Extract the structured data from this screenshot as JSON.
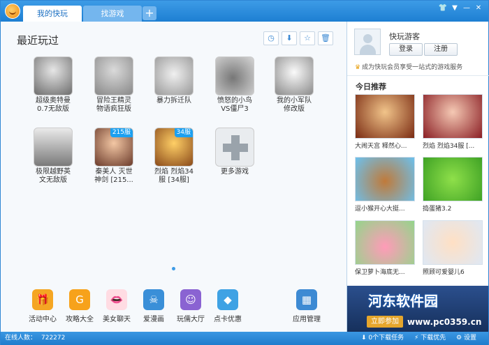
{
  "tabs": [
    {
      "label": "我的快玩"
    },
    {
      "label": "找游戏"
    }
  ],
  "tab_add_label": "+",
  "window_controls": [
    "👕",
    "▼",
    "—",
    "✕"
  ],
  "recent": {
    "title": "最近玩过",
    "tools": [
      {
        "icon": "clock-icon",
        "glyph": "◷"
      },
      {
        "icon": "download-icon",
        "glyph": "⬇"
      },
      {
        "icon": "star-icon",
        "glyph": "☆"
      },
      {
        "icon": "trash-icon",
        "glyph": "🗑"
      }
    ],
    "games": [
      {
        "name": "超级奥特曼\n0.7无敌版"
      },
      {
        "name": "冒险王精灵\n物语疯狂版"
      },
      {
        "name": "暴力拆迁队"
      },
      {
        "name": "愤怒的小鸟\nVS僵尸3"
      },
      {
        "name": "我的小军队\n修改版"
      },
      {
        "name": "极限越野英\n文无敌版"
      },
      {
        "name": "秦美人 灭世\n神剑 [215...",
        "badge": "215服"
      },
      {
        "name": "烈焰 烈焰34\n服 [34服]",
        "badge": "34服"
      },
      {
        "name": "更多游戏"
      }
    ]
  },
  "dock": [
    {
      "label": "活动中心",
      "icon": "gift-icon",
      "color": "#f5a623",
      "glyph": "🎁"
    },
    {
      "label": "攻略大全",
      "icon": "guide-icon",
      "color": "#f7a21b",
      "glyph": "G"
    },
    {
      "label": "美女聊天",
      "icon": "lips-icon",
      "color": "#ffdce3",
      "glyph": "👄"
    },
    {
      "label": "爱漫画",
      "icon": "comic-icon",
      "color": "#3a8fd8",
      "glyph": "☠"
    },
    {
      "label": "玩儒大厅",
      "icon": "chat-icon",
      "color": "#8a63d2",
      "glyph": "☺"
    },
    {
      "label": "点卡优惠",
      "icon": "diamond-icon",
      "color": "#3fa2e4",
      "glyph": "◆"
    },
    {
      "label": "应用管理",
      "icon": "apps-icon",
      "color": "#3d8ad3",
      "glyph": "▦"
    }
  ],
  "user": {
    "name": "快玩游客",
    "login_label": "登录",
    "register_label": "注册",
    "promo": "成为快玩会员享受一站式的游戏服务"
  },
  "today": {
    "title": "今日推荐",
    "items": [
      {
        "label": "大闹天宫 释然心..."
      },
      {
        "label": "烈焰 烈焰34服 [..."
      },
      {
        "label": "逗小猴开心大挺..."
      },
      {
        "label": "捣蛋猪3.2"
      },
      {
        "label": "保卫萝卜海底无..."
      },
      {
        "label": "照顾可爱婴儿6"
      }
    ]
  },
  "ad": {
    "title": "河东软件园",
    "button": "立即参加",
    "url": "www.pc0359.cn"
  },
  "status": {
    "online_label": "在线人数：",
    "online_count": "722272",
    "downloads": "0个下载任务",
    "priority": "下载优先",
    "settings": "设置"
  }
}
